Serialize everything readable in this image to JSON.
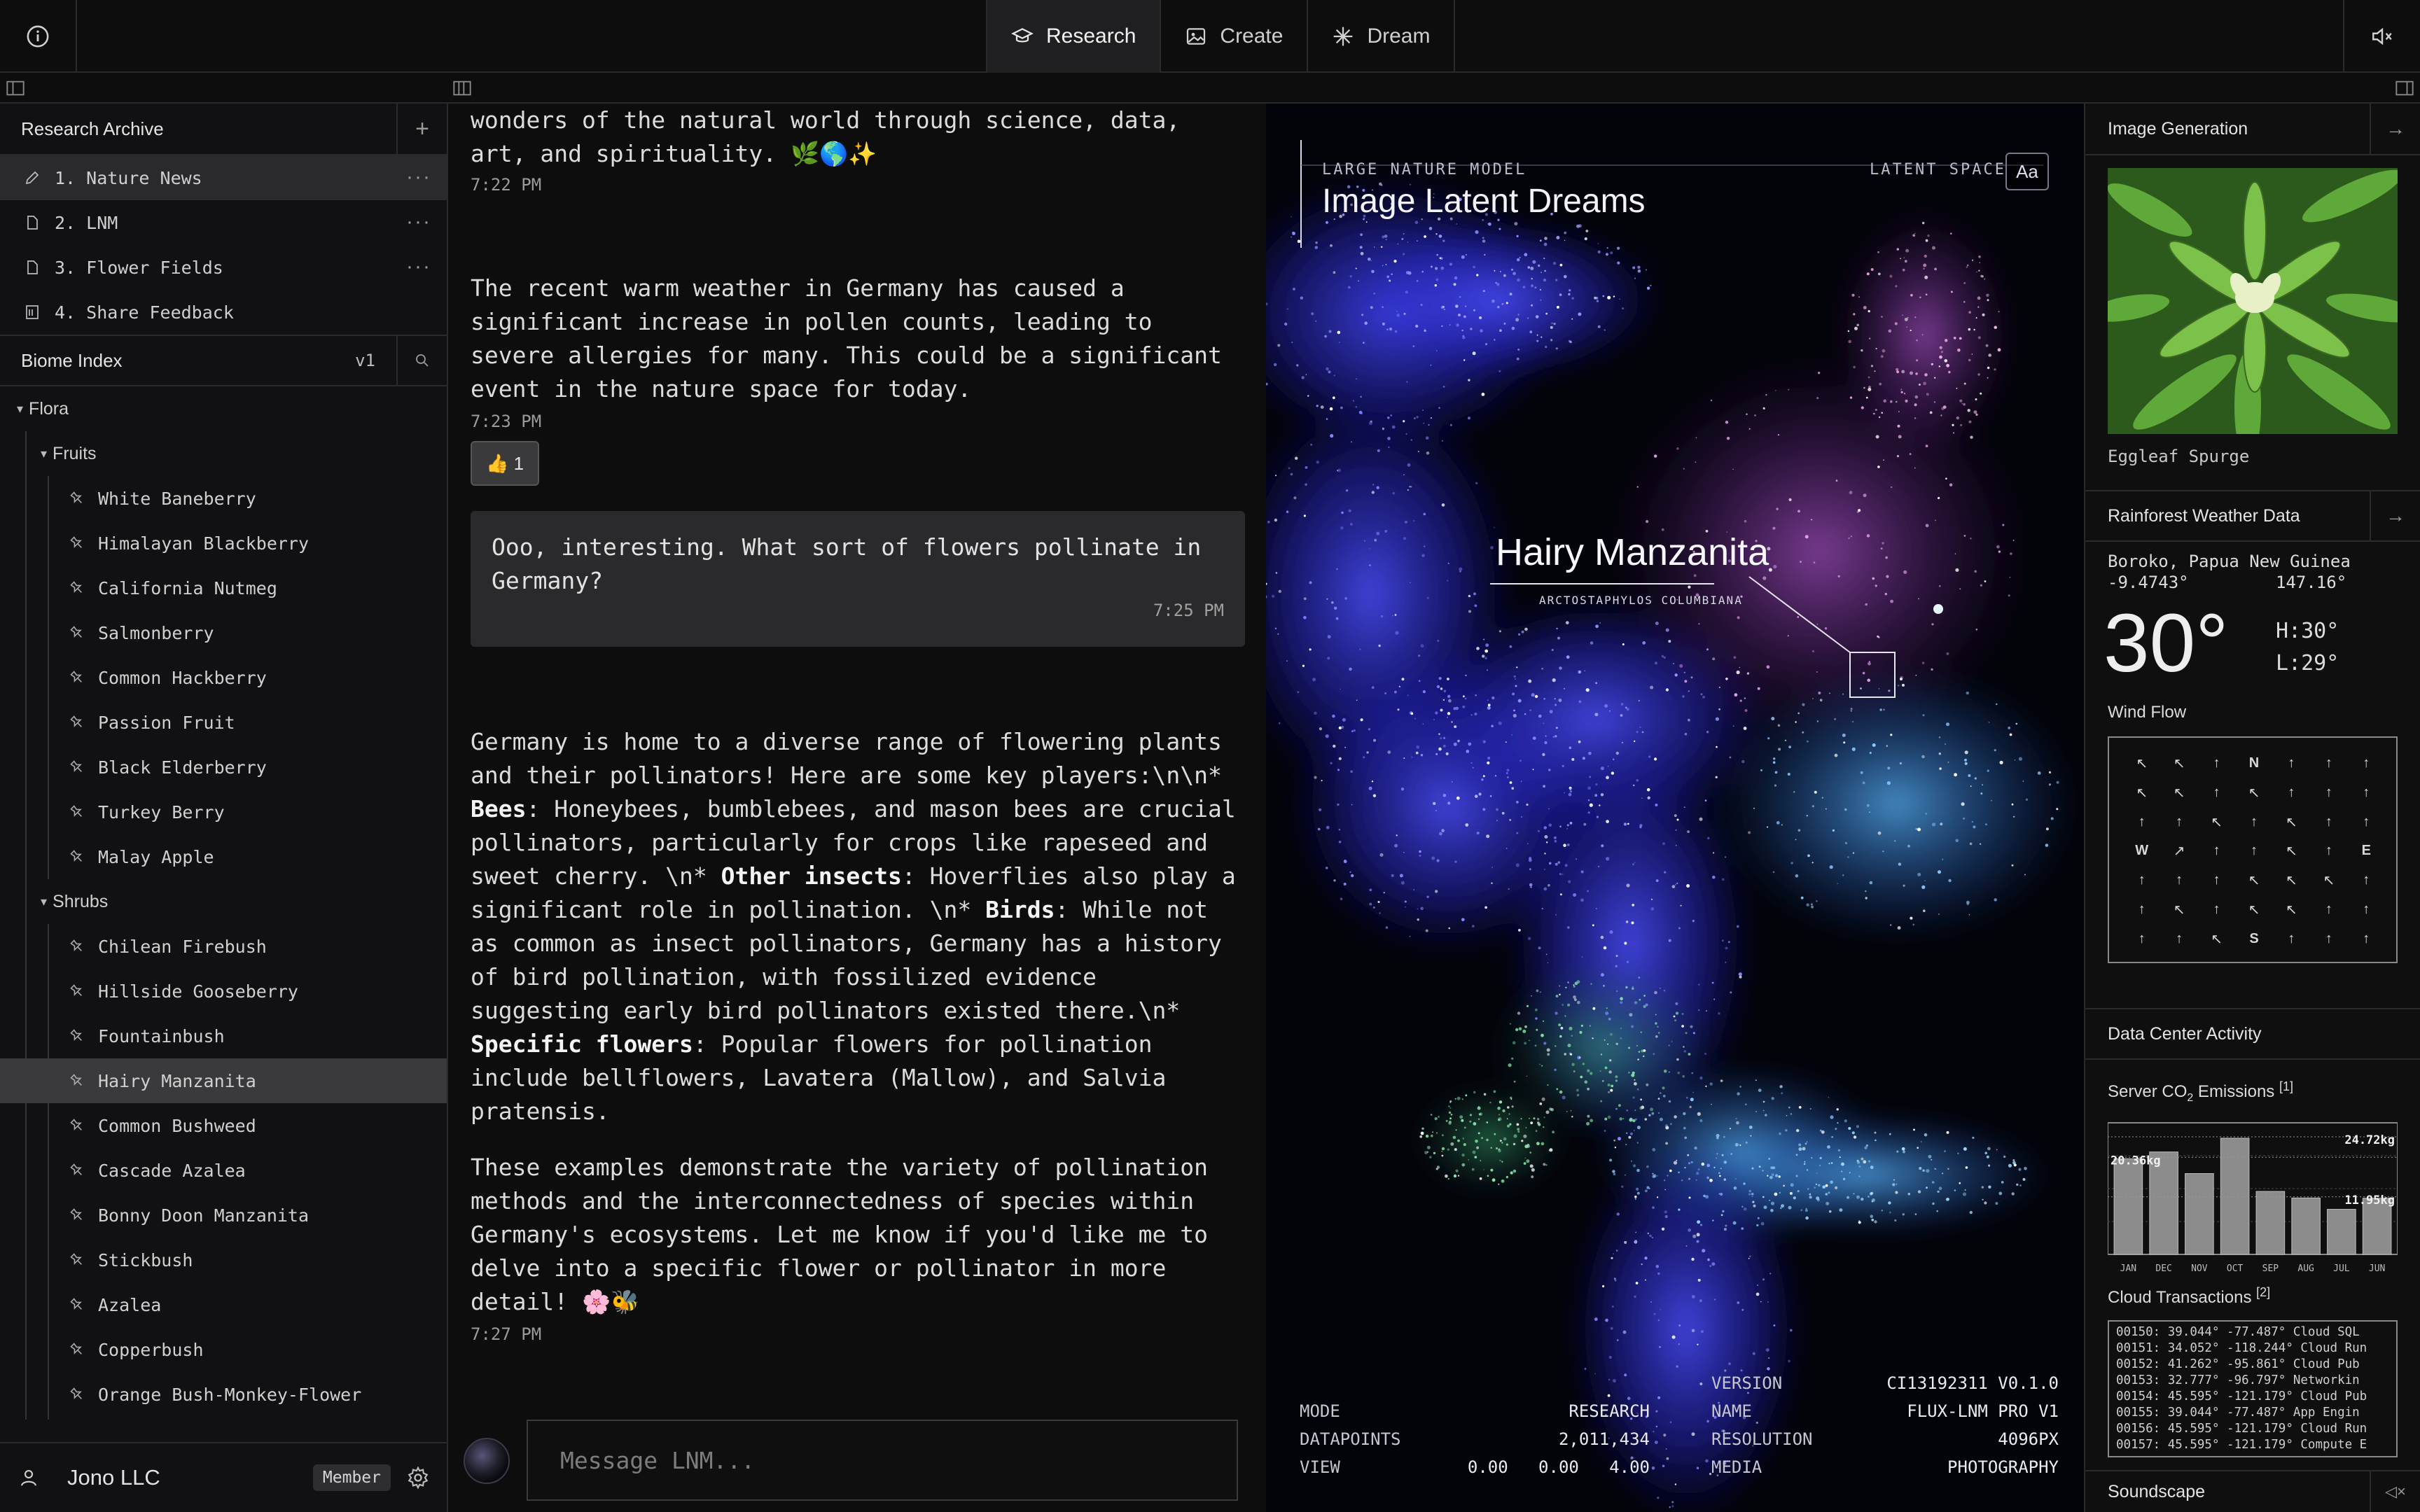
{
  "topbar": {
    "tabs": [
      {
        "label": "Research",
        "icon": "graduation-cap-icon"
      },
      {
        "label": "Create",
        "icon": "image-icon"
      },
      {
        "label": "Dream",
        "icon": "sparkle-icon"
      }
    ]
  },
  "sidebar": {
    "archive_title": "Research Archive",
    "archive_add": "+",
    "archive_items": [
      {
        "label": "1. Nature News",
        "icon": "pencil-icon"
      },
      {
        "label": "2. LNM",
        "icon": "document-icon"
      },
      {
        "label": "3. Flower Fields",
        "icon": "document-icon"
      },
      {
        "label": "4. Share Feedback",
        "icon": "form-icon"
      }
    ],
    "biome_title": "Biome Index",
    "biome_version": "v1",
    "tree": {
      "root": "Flora",
      "groups": [
        {
          "label": "Fruits",
          "items": [
            "White Baneberry",
            "Himalayan Blackberry",
            "California Nutmeg",
            "Salmonberry",
            "Common Hackberry",
            "Passion Fruit",
            "Black Elderberry",
            "Turkey Berry",
            "Malay Apple"
          ]
        },
        {
          "label": "Shrubs",
          "items": [
            "Chilean Firebush",
            "Hillside Gooseberry",
            "Fountainbush",
            "Hairy Manzanita",
            "Common Bushweed",
            "Cascade Azalea",
            "Bonny Doon Manzanita",
            "Stickbush",
            "Azalea",
            "Copperbush",
            "Orange Bush-Monkey-Flower"
          ]
        }
      ],
      "selected": "Hairy Manzanita"
    },
    "user": {
      "name": "Jono LLC",
      "badge": "Member"
    }
  },
  "chat": {
    "intro_line1": "wonders of the natural world through science, data,",
    "intro_line2": "art, and spirituality. 🌿🌎✨",
    "intro_time": "7:22 PM",
    "news_lines": [
      "The recent warm weather in Germany has caused a",
      "significant increase in pollen counts, leading to",
      "severe allergies for many. This could be a significant",
      "event in the nature space for today."
    ],
    "news_time": "7:23 PM",
    "reaction": "👍 1",
    "user_msg_line1": "Ooo, interesting. What sort of flowers pollinate in",
    "user_msg_line2": "Germany?",
    "user_msg_time": "7:25 PM",
    "reply": {
      "l1": "Germany is home to a diverse range of flowering plants",
      "l2": "and their pollinators! Here are some key players:\\n\\n*",
      "l3_b": "Bees",
      "l3": ": Honeybees, bumblebees, and mason bees are crucial",
      "l4": "pollinators, particularly for crops like rapeseed and",
      "l5a": "sweet cherry. \\n* ",
      "l5_b": "Other insects",
      "l5c": ": Hoverflies also play a",
      "l6a": "significant role in pollination. \\n* ",
      "l6_b": "Birds",
      "l6c": ": While not",
      "l7": "as common as insect pollinators, Germany has a history",
      "l8": "of bird pollination, with fossilized evidence",
      "l9": "suggesting early bird pollinators existed there.\\n*",
      "l10_b": "Specific flowers",
      "l10": ": Popular flowers for pollination",
      "l11": "include bellflowers, Lavatera (Mallow), and Salvia",
      "l12": "pratensis.",
      "p2_1": "These examples demonstrate the variety of pollination",
      "p2_2": "methods and the interconnectedness of species within",
      "p2_3": "Germany's ecosystems. Let me know if you'd like me to",
      "p2_4": "delve into a specific flower or pollinator in more",
      "p2_5": "detail! 🌸🐝"
    },
    "reply_time": "7:27 PM",
    "composer_placeholder": "Message LNM..."
  },
  "viz": {
    "overline": "LARGE NATURE MODEL",
    "title": "Image Latent Dreams",
    "latent_label": "LATENT SPACE",
    "font_button": "Aa",
    "focus_name": "Hairy Manzanita",
    "focus_latin": "ARCTOSTAPHYLOS COLUMBIANA",
    "stats": {
      "mode_label": "MODE",
      "mode_value": "RESEARCH",
      "datapoints_label": "DATAPOINTS",
      "datapoints_value": "2,011,434",
      "view_label": "VIEW",
      "view_v1": "0.00",
      "view_v2": "0.00",
      "view_v3": "4.00",
      "version_label": "VERSION",
      "version_value": "CI13192311 V0.1.0",
      "name_label": "NAME",
      "name_value": "FLUX-LNM PRO V1",
      "resolution_label": "RESOLUTION",
      "resolution_value": "4096PX",
      "media_label": "MEDIA",
      "media_value": "PHOTOGRAPHY"
    }
  },
  "right": {
    "imagegen_title": "Image Generation",
    "imagegen_caption": "Eggleaf Spurge",
    "weather_title": "Rainforest Weather Data",
    "location": "Boroko, Papua New Guinea",
    "lat": "-9.4743°",
    "lon": "147.16°",
    "temp": "30°",
    "high": "H:30°",
    "low": "L:29°",
    "wind_label": "Wind Flow",
    "wind_grid": [
      [
        "↖",
        "↖",
        "↑",
        "N",
        "↑",
        "↑",
        "↑"
      ],
      [
        "↖",
        "↖",
        "↑",
        "↖",
        "↑",
        "↑",
        "↑"
      ],
      [
        "↑",
        "↑",
        "↖",
        "↑",
        "↖",
        "↑",
        "↑"
      ],
      [
        "W",
        "↗",
        "↑",
        "↑",
        "↖",
        "↑",
        "E"
      ],
      [
        "↑",
        "↑",
        "↑",
        "↖",
        "↖",
        "↖",
        "↑"
      ],
      [
        "↑",
        "↖",
        "↑",
        "↖",
        "↖",
        "↑",
        "↑"
      ],
      [
        "↑",
        "↑",
        "↖",
        "S",
        "↑",
        "↑",
        "↑"
      ]
    ],
    "dc_title": "Data Center Activity",
    "co2_label_a": "Server CO",
    "co2_label_sub": "2",
    "co2_label_b": " Emissions",
    "co2_ref": "[1]",
    "chart_data": {
      "type": "bar",
      "categories": [
        "JAN",
        "DEC",
        "NOV",
        "OCT",
        "SEP",
        "AUG",
        "JUL",
        "JUN"
      ],
      "values": [
        20.36,
        21.8,
        17.2,
        24.72,
        13.4,
        12.0,
        9.6,
        11.95
      ],
      "annotations": [
        "24.72kg",
        "20.36kg",
        "11.95kg"
      ],
      "ylim": [
        0,
        28
      ],
      "grid": true
    },
    "tx_title": "Cloud Transactions",
    "tx_ref": "[2]",
    "tx_rows": [
      "00150: 39.044° -77.487° Cloud SQL",
      "00151: 34.052° -118.244° Cloud Run",
      "00152: 41.262° -95.861° Cloud Pub",
      "00153: 32.777° -96.797° Networkin",
      "00154: 45.595° -121.179° Cloud Pub",
      "00155: 39.044° -77.487° App Engin",
      "00156: 45.595° -121.179° Cloud Run",
      "00157: 45.595° -121.179° Compute E"
    ],
    "soundscape_title": "Soundscape"
  }
}
